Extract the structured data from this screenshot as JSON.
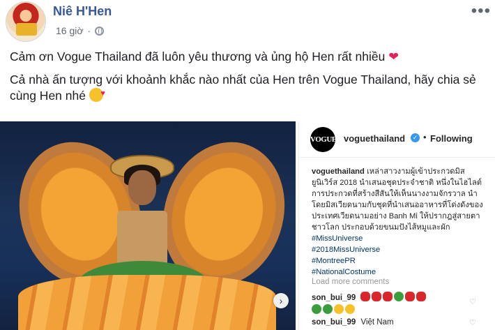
{
  "post": {
    "author": "Niê H'Hen",
    "time": "16 giờ",
    "more": "•••",
    "line1": "Cảm ơn Vogue Thailand đã luôn yêu thương và ủng hộ Hen rất nhiều",
    "line1_emoji": "❤",
    "line2": "Cả nhà ấn tượng với khoảnh khắc nào nhất của Hen trên Vogue Thailand, hãy chia sẻ cùng Hen nhé"
  },
  "instagram": {
    "logo_text": "VOGUE",
    "username": "voguethailand",
    "dot": "•",
    "follow_label": "Following",
    "caption_user": "voguethailand",
    "caption_text": "เหล่าสาวงามผู้เข้าประกวดมิสยูนิเวิร์ส 2018 นำเสนอชุดประจำชาติ หนึ่งในไฮไลต์การประกวดที่สร้างสีสันให้เห็นนางงามจักรวาล นำโดยมิสเวียดนามกับชุดที่นำเสนออาหารที่โด่งดังของประเทศเวียดนามอย่าง Banh Mi ให้ปรากฎสู่สายตาชาวโลก ประกอบด้วยขนมปังไส้หมูและผัก",
    "tags": [
      "#MissUniverse",
      "#2018MissUniverse",
      "#MontreePR",
      "#NationalCostume"
    ],
    "load_more": "Load more comments",
    "comments": [
      {
        "user": "son_bui_99",
        "text": ""
      },
      {
        "user": "son_bui_99",
        "text": "Việt Nam"
      }
    ]
  },
  "colors": {
    "author": "#385898",
    "verified": "#3897f0",
    "hashtag": "#003569"
  }
}
